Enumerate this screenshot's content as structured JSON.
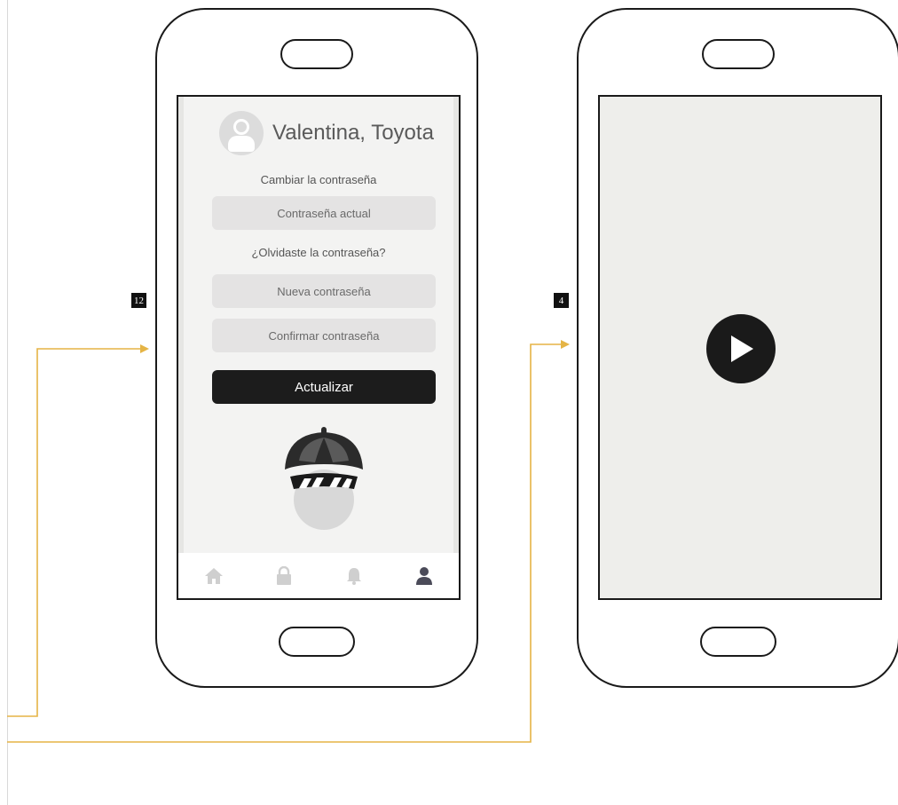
{
  "colors": {
    "connector": "#e5b445",
    "screen_bg": "#eeeeeb",
    "button_dark": "#1c1c1c",
    "tab_active": "#4b4b59",
    "tab_inactive": "#cfcfcf"
  },
  "step_left": {
    "badge": "12"
  },
  "step_right": {
    "badge": "4"
  },
  "profile": {
    "user_name": "Valentina, Toyota",
    "section_title": "Cambiar la contraseña",
    "current_password_placeholder": "Contraseña actual",
    "forgot_password": "¿Olvidaste la contraseña?",
    "new_password_placeholder": "Nueva contraseña",
    "confirm_password_placeholder": "Confirmar contraseña",
    "update_label": "Actualizar"
  },
  "tabbar": {
    "items": [
      "home-icon",
      "lock-icon",
      "bell-icon",
      "user-icon"
    ],
    "active": "user-icon"
  },
  "video": {
    "icon": "play-icon"
  }
}
